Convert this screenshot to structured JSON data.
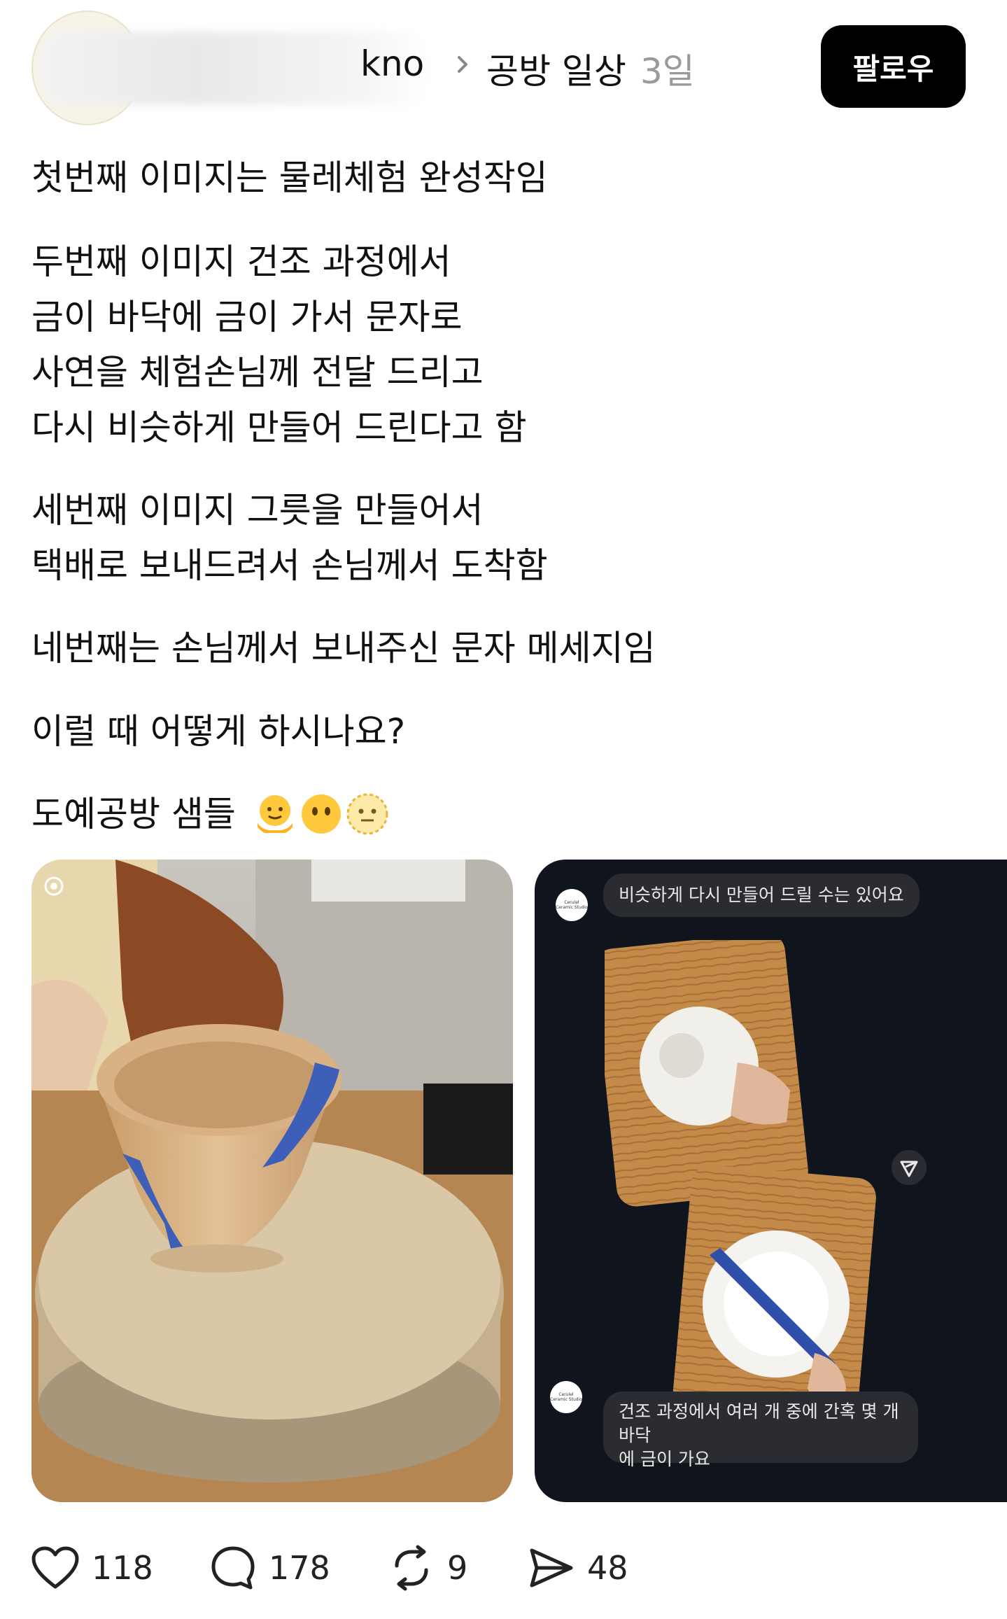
{
  "header": {
    "username_visible": "kno",
    "topic": "공방 일상",
    "time_ago": "3일",
    "follow_label": "팔로우"
  },
  "post": {
    "lines": [
      "첫번째 이미지는 물레체험 완성작임",
      "두번째 이미지 건조 과정에서",
      "금이 바닥에 금이 가서 문자로",
      "사연을 체험손님께 전달 드리고",
      "다시 비슷하게 만들어 드린다고 함",
      "세번째 이미지 그릇을 만들어서",
      "택배로 보내드려서 손님께서 도착함",
      "네번째는 손님께서 보내주신 문자 메세지임",
      "이럴 때 어떻게 하시나요?",
      "도예공방 샘들"
    ]
  },
  "chat_image": {
    "bubble_top": "비슷하게 다시 만들어 드릴 수는 있어요",
    "bubble_bottom_line1": "건조 과정에서 여러 개 중에 간혹 몇 개 바닥",
    "bubble_bottom_line2": "에 금이 가요",
    "studio_name": "Cerulel Ceramic Studio"
  },
  "actions": {
    "likes": "118",
    "comments": "178",
    "reposts": "9",
    "shares": "48"
  },
  "colors": {
    "follow_bg": "#000000",
    "chat_bg": "#10141c",
    "bubble_bg": "#2a2c31",
    "glaze_blue": "#3d5fb8",
    "clay": "#d8b58a",
    "wood": "#c48a4a"
  }
}
